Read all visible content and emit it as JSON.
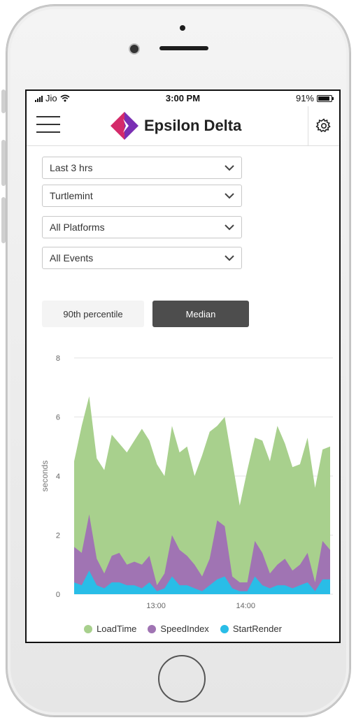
{
  "status": {
    "carrier": "Jio",
    "time": "3:00 PM",
    "battery": "91%"
  },
  "app": {
    "title": "Epsilon Delta"
  },
  "filters": [
    {
      "value": "Last 3 hrs"
    },
    {
      "value": "Turtlemint"
    },
    {
      "value": "All Platforms"
    },
    {
      "value": "All Events"
    }
  ],
  "toggle": {
    "option1": "90th percentile",
    "option2": "Median",
    "selected": "Median"
  },
  "chart_data": {
    "type": "area",
    "stacked": false,
    "ylabel": "seconds",
    "xlabel": "",
    "ylim": [
      0,
      8
    ],
    "yticks": [
      0,
      2,
      4,
      6,
      8
    ],
    "xticks": [
      "13:00",
      "14:00"
    ],
    "grid": true,
    "legend_position": "bottom",
    "series": [
      {
        "name": "LoadTime",
        "color": "#a8d08d",
        "values": [
          4.5,
          5.7,
          6.7,
          4.6,
          4.2,
          5.4,
          5.1,
          4.8,
          5.2,
          5.6,
          5.2,
          4.4,
          4.0,
          5.7,
          4.8,
          5.0,
          4.0,
          4.7,
          5.5,
          5.7,
          6.0,
          4.5,
          3.0,
          4.2,
          5.3,
          5.2,
          4.5,
          5.7,
          5.1,
          4.3,
          4.4,
          5.3,
          3.6,
          4.9,
          5.0
        ]
      },
      {
        "name": "SpeedIndex",
        "color": "#a074b3",
        "values": [
          1.6,
          1.4,
          2.7,
          1.2,
          0.7,
          1.3,
          1.4,
          1.0,
          1.1,
          1.0,
          1.3,
          0.3,
          0.7,
          2.0,
          1.5,
          1.3,
          1.0,
          0.6,
          1.2,
          2.5,
          2.3,
          0.6,
          0.4,
          0.4,
          1.8,
          1.4,
          0.7,
          1.0,
          1.2,
          0.8,
          1.0,
          1.4,
          0.4,
          1.8,
          1.5
        ]
      },
      {
        "name": "StartRender",
        "color": "#29bde7",
        "values": [
          0.4,
          0.3,
          0.8,
          0.3,
          0.2,
          0.4,
          0.4,
          0.3,
          0.3,
          0.2,
          0.4,
          0.1,
          0.2,
          0.6,
          0.3,
          0.3,
          0.2,
          0.1,
          0.3,
          0.5,
          0.6,
          0.2,
          0.1,
          0.1,
          0.6,
          0.3,
          0.2,
          0.3,
          0.3,
          0.2,
          0.3,
          0.4,
          0.1,
          0.5,
          0.5
        ]
      }
    ]
  },
  "colors": {
    "accent_dark": "#4d4d4d",
    "logo_left": "#d42a6a",
    "logo_right": "#7a2fb3"
  }
}
